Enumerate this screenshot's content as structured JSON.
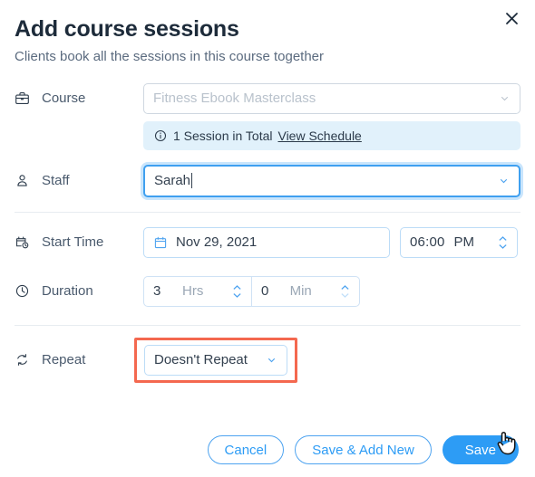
{
  "dialog": {
    "title": "Add course sessions",
    "subtitle": "Clients book all the sessions in this course together",
    "close_icon": "close-icon"
  },
  "fields": {
    "course": {
      "icon": "briefcase-icon",
      "label": "Course",
      "value": "Fitness Ebook Masterclass",
      "placeholder": "Fitness Ebook Masterclass",
      "chevron_icon": "chevron-down-icon",
      "info": {
        "icon": "info-icon",
        "text": "1 Session in Total",
        "link": "View Schedule"
      }
    },
    "staff": {
      "icon": "user-icon",
      "label": "Staff",
      "value": "Sarah",
      "chevron_icon": "chevron-down-icon",
      "focused": true
    },
    "start_time": {
      "icon": "calendar-clock-icon",
      "label": "Start Time",
      "date_icon": "calendar-icon",
      "date": "Nov 29, 2021",
      "time": "06:00",
      "meridiem": "PM",
      "stepper_icon": "stepper-updown-icon"
    },
    "duration": {
      "icon": "clock-icon",
      "label": "Duration",
      "hours_value": "3",
      "hours_unit": "Hrs",
      "minutes_value": "0",
      "minutes_unit": "Min",
      "stepper_icon": "stepper-updown-icon"
    },
    "repeat": {
      "icon": "repeat-icon",
      "label": "Repeat",
      "value": "Doesn't Repeat",
      "chevron_icon": "chevron-down-icon",
      "highlighted": true,
      "highlight_color": "#f4684f"
    }
  },
  "footer": {
    "cancel_label": "Cancel",
    "save_add_new_label": "Save & Add New",
    "save_label": "Save",
    "cursor_icon": "hand-cursor-icon"
  },
  "colors": {
    "accent": "#2d9cf5",
    "title": "#1d2b3a",
    "label": "#4a5a6d",
    "info_bg": "#e1f1fb",
    "highlight": "#f4684f"
  }
}
